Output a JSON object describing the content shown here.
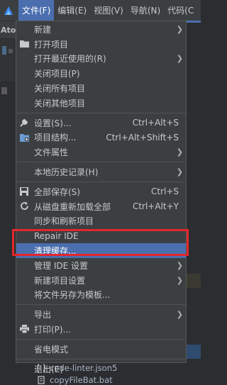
{
  "menubar": {
    "logo_icon": "app-logo-icon",
    "items": [
      "文件(F)",
      "编辑(E)",
      "视图(V)",
      "导航(N)",
      "代码(C"
    ]
  },
  "background": {
    "window_title_fragment": "Ator",
    "bottom_files": [
      "code-linter.json5",
      "copyFileBat.bat"
    ]
  },
  "file_menu": {
    "new": "新建",
    "open_project": "打开项目",
    "open_recent": "打开最近使用的(R)",
    "close_project": "关闭项目(P)",
    "close_all_projects": "关闭所有项目",
    "close_other_projects": "关闭其他项目",
    "settings": "设置(S)...",
    "settings_shortcut": "Ctrl+Alt+S",
    "project_structure": "项目结构...",
    "project_structure_shortcut": "Ctrl+Alt+Shift+S",
    "file_properties": "文件属性",
    "local_history": "本地历史记录(H)",
    "save_all": "全部保存(S)",
    "save_all_shortcut": "Ctrl+S",
    "reload_from_disk": "从磁盘重新加载全部",
    "reload_from_disk_shortcut": "Ctrl+Alt+Y",
    "sync_refresh": "同步和刷新项目",
    "repair_ide": "Repair IDE",
    "invalidate_caches": "清理缓存...",
    "manage_ide_settings": "管理 IDE 设置",
    "new_project_settings": "新建项目设置",
    "save_as_template": "将文件另存为模板...",
    "export": "导出",
    "print": "打印(P)...",
    "power_save_mode": "省电模式",
    "exit": "退出(E)"
  },
  "colors": {
    "menubar_bg": "#3c3f41",
    "selection": "#4b6eaf",
    "highlight_border": "#e3272c"
  }
}
